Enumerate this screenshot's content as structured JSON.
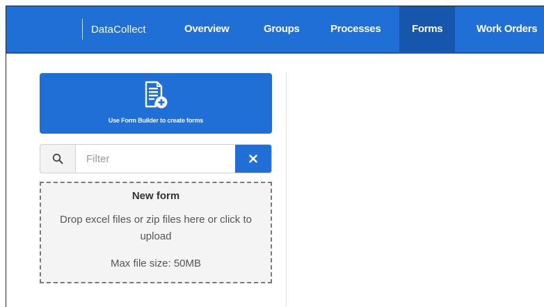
{
  "app": {
    "name": "DataCollect"
  },
  "nav": {
    "items": [
      {
        "label": "Overview",
        "active": false
      },
      {
        "label": "Groups",
        "active": false
      },
      {
        "label": "Processes",
        "active": false
      },
      {
        "label": "Forms",
        "active": true
      },
      {
        "label": "Work Orders",
        "active": false
      }
    ]
  },
  "form_builder": {
    "label": "Use Form Builder to create forms",
    "icon": "form-add-icon"
  },
  "filter": {
    "placeholder": "Filter",
    "value": "",
    "search_icon": "search-icon",
    "clear_icon": "close-icon"
  },
  "dropzone": {
    "title": "New form",
    "instructions": "Drop excel files or zip files here or click to upload",
    "max_size": "Max file size: 50MB"
  },
  "colors": {
    "primary": "#1f6fd6",
    "primary_dark": "#1657ad",
    "dropzone_bg": "#f4f4f4"
  }
}
